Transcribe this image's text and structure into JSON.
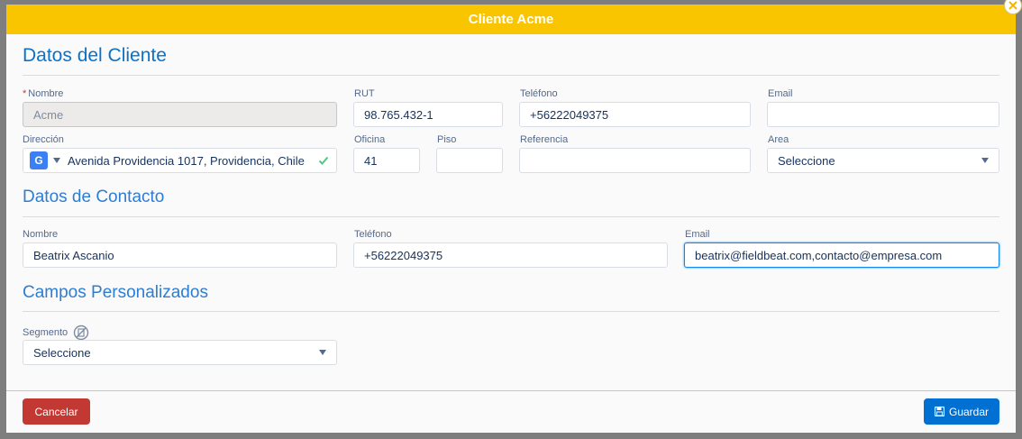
{
  "modal": {
    "title": "Cliente Acme"
  },
  "client_section": {
    "title": "Datos del Cliente",
    "required_mark": "*",
    "name_label": "Nombre",
    "name_value": "Acme",
    "rut_label": "RUT",
    "rut_value": "98.765.432-1",
    "phone_label": "Teléfono",
    "phone_value": "+56222049375",
    "email_label": "Email",
    "email_value": "",
    "address_label": "Dirección",
    "address_value": "Avenida Providencia 1017, Providencia, Chile",
    "address_provider_badge": "G",
    "office_label": "Oficina",
    "office_value": "41",
    "floor_label": "Piso",
    "floor_value": "",
    "reference_label": "Referencia",
    "reference_value": "",
    "area_label": "Area",
    "area_value": "Seleccione"
  },
  "contact_section": {
    "title": "Datos de Contacto",
    "name_label": "Nombre",
    "name_value": "Beatrix Ascanio",
    "phone_label": "Teléfono",
    "phone_value": "+56222049375",
    "email_label": "Email",
    "email_value": "beatrix@fieldbeat.com,contacto@empresa.com"
  },
  "custom_section": {
    "title": "Campos Personalizados",
    "segment_label": "Segmento",
    "segment_value": "Seleccione"
  },
  "footer": {
    "cancel_label": "Cancelar",
    "save_label": "Guardar"
  },
  "colors": {
    "header": "#f8c500",
    "accent": "#0070d2",
    "danger": "#c23934"
  },
  "icons": {
    "close": "close-icon",
    "google": "google-icon",
    "check": "check-icon",
    "segment_info": "pencil-slash-icon",
    "save": "floppy-disk-icon"
  }
}
